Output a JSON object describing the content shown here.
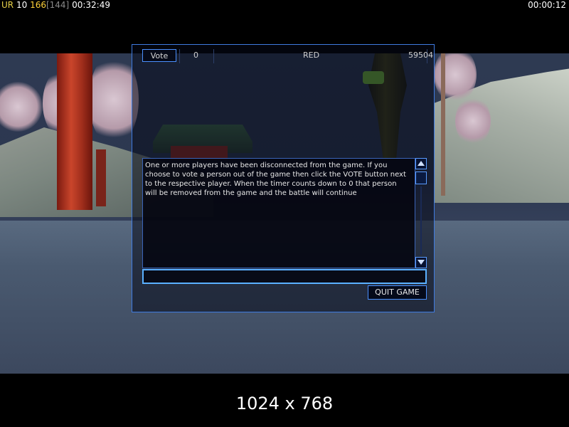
{
  "hud": {
    "team_code": "UR",
    "kills": "10",
    "score": "166",
    "score_bracket": "[144]",
    "elapsed_time": "00:32:49",
    "countdown": "00:00:12"
  },
  "dialog": {
    "vote_row": {
      "vote_label": "Vote",
      "vote_count": "0",
      "team": "RED",
      "score": "59504"
    },
    "message": "One or more players have been disconnected from the game. If you choose to vote a person out of the game then click the VOTE button next to the respective player. When the timer counts down to 0 that person will be removed from the game and the battle will continue",
    "chat_input_value": "",
    "quit_label": "QUIT GAME"
  },
  "resolution_caption": "1024 x 768",
  "colors": {
    "accent_border": "#4a90ff",
    "hud_yellow": "#ffd23a",
    "hud_gray": "#8a8a8a"
  },
  "icons": {
    "scroll_up": "triangle-up-icon",
    "scroll_down": "triangle-down-icon"
  }
}
